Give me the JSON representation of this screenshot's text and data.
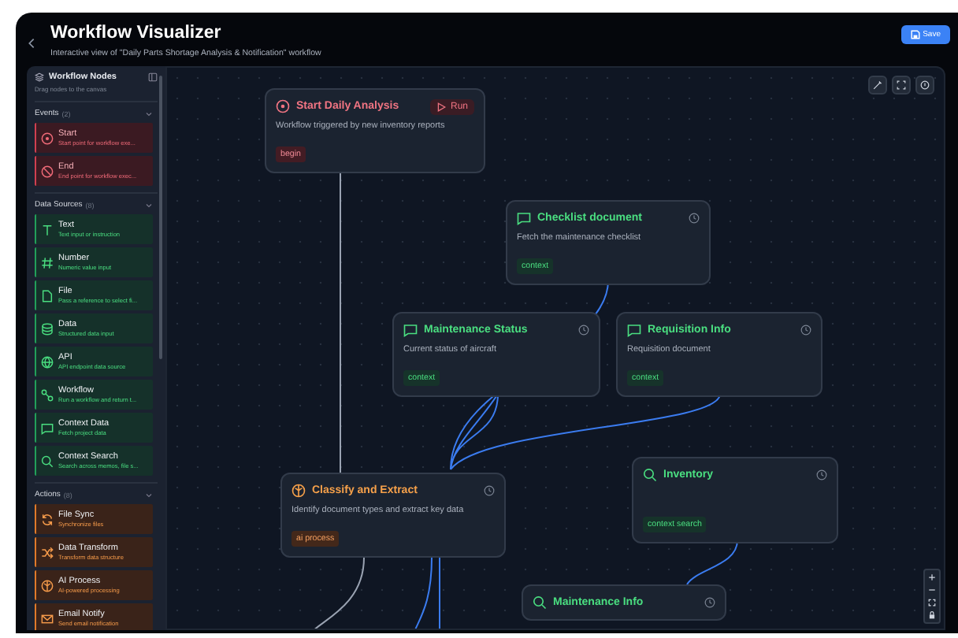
{
  "header": {
    "title": "Workflow Visualizer",
    "subtitle": "Interactive view of \"Daily Parts Shortage Analysis & Notification\" workflow",
    "save_button": "Save"
  },
  "sidebar": {
    "title": "Workflow Nodes",
    "hint": "Drag nodes to the canvas",
    "sections": [
      {
        "kind": "event",
        "title": "Events",
        "count": "(2)",
        "expanded": true,
        "items": [
          {
            "label": "Start",
            "description": "Start point for workflow exe..."
          },
          {
            "label": "End",
            "description": "End point for workflow exec..."
          }
        ]
      },
      {
        "kind": "data",
        "title": "Data Sources",
        "count": "(8)",
        "expanded": true,
        "items": [
          {
            "label": "Text",
            "description": "Text input or instruction"
          },
          {
            "label": "Number",
            "description": "Numeric value input"
          },
          {
            "label": "File",
            "description": "Pass a reference to select fi..."
          },
          {
            "label": "Data",
            "description": "Structured data input"
          },
          {
            "label": "API",
            "description": "API endpoint data source"
          },
          {
            "label": "Workflow",
            "description": "Run a workflow and return t..."
          },
          {
            "label": "Context Data",
            "description": "Fetch project data"
          },
          {
            "label": "Context Search",
            "description": "Search across memos, file s..."
          }
        ]
      },
      {
        "kind": "action",
        "title": "Actions",
        "count": "(8)",
        "expanded": true,
        "items": [
          {
            "label": "File Sync",
            "description": "Synchronize files"
          },
          {
            "label": "Data Transform",
            "description": "Transform data structure"
          },
          {
            "label": "AI Process",
            "description": "AI-powered processing"
          },
          {
            "label": "Email Notify",
            "description": "Send email notification"
          }
        ]
      }
    ]
  },
  "canvas": {
    "nodes": [
      {
        "kind": "trigger",
        "title": "Start Daily Analysis",
        "description": "Workflow triggered by new inventory reports",
        "tag": "begin",
        "run_button": "Run"
      },
      {
        "kind": "context",
        "title": "Checklist document",
        "description": "Fetch the maintenance checklist",
        "tag": "context"
      },
      {
        "kind": "context",
        "title": "Maintenance Status",
        "description": "Current status of aircraft",
        "tag": "context"
      },
      {
        "kind": "context",
        "title": "Requisition Info",
        "description": "Requisition document",
        "tag": "context"
      },
      {
        "kind": "search",
        "title": "Inventory",
        "tag": "context search"
      },
      {
        "kind": "ai",
        "title": "Classify and Extract",
        "description": "Identify document types and extract key data",
        "tag": "ai process"
      },
      {
        "kind": "search",
        "title": "Maintenance Info"
      }
    ]
  }
}
